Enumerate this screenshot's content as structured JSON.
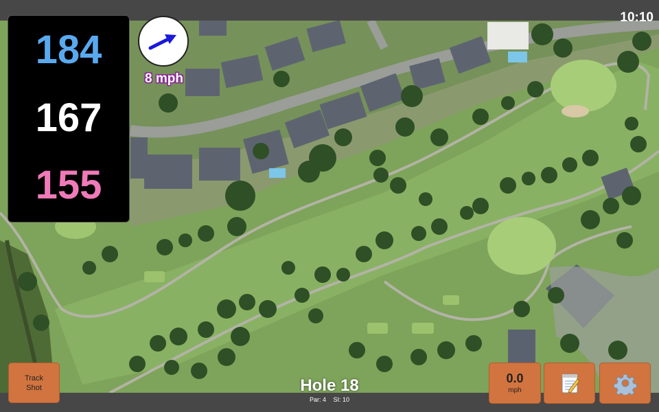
{
  "status_bar": {
    "time": "10:10"
  },
  "distances": {
    "back": "184",
    "middle": "167",
    "front": "155"
  },
  "wind": {
    "speed_label": "8 mph",
    "direction_icon": "arrow-icon"
  },
  "buttons": {
    "track_shot_line1": "Track",
    "track_shot_line2": "Shot",
    "speed_value": "0.0",
    "speed_unit": "mph",
    "notes_icon": "notepad-icon",
    "settings_icon": "gear-icon"
  },
  "hole": {
    "title": "Hole 18",
    "par": "Par: 4",
    "si": "SI: 10"
  },
  "colors": {
    "back_distance": "#5aa9ee",
    "middle_distance": "#ffffff",
    "front_distance": "#f07ab8",
    "button": "#d2743f",
    "wind_arrow": "#1a1ad9"
  }
}
